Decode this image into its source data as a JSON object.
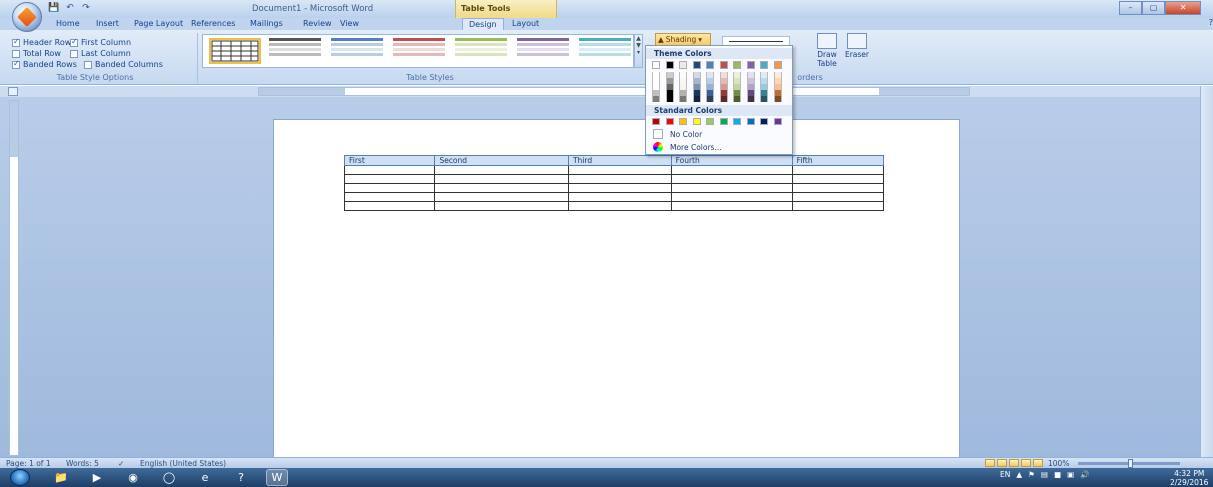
{
  "window": {
    "title": "Document1 - Microsoft Word",
    "context_tab": "Table Tools",
    "controls": [
      "–",
      "▢",
      "✕"
    ]
  },
  "tabs": [
    "Home",
    "Insert",
    "Page Layout",
    "References",
    "Mailings",
    "Review",
    "View",
    "Design",
    "Layout"
  ],
  "active_tab": "Design",
  "ribbon": {
    "table_style_options": {
      "label": "Table Style Options",
      "options": [
        {
          "label": "Header Row",
          "checked": true
        },
        {
          "label": "First Column",
          "checked": true
        },
        {
          "label": "Total Row",
          "checked": false
        },
        {
          "label": "Last Column",
          "checked": false
        },
        {
          "label": "Banded Rows",
          "checked": true
        },
        {
          "label": "Banded Columns",
          "checked": false
        }
      ]
    },
    "table_styles": {
      "label": "Table Styles"
    },
    "shading_button": "Shading",
    "borders_label": "orders",
    "draw_table": "Draw Table",
    "eraser": "Eraser"
  },
  "shading_menu": {
    "theme_colors_label": "Theme Colors",
    "standard_colors_label": "Standard Colors",
    "no_color": "No Color",
    "more_colors": "More Colors...",
    "theme_row": [
      "#ffffff",
      "#000000",
      "#eeece1",
      "#1f497d",
      "#4f81bd",
      "#c0504d",
      "#9bbb59",
      "#8064a2",
      "#4bacc6",
      "#f79646"
    ],
    "standard_row": [
      "#c00000",
      "#ff0000",
      "#ffc000",
      "#ffff00",
      "#92d050",
      "#00b050",
      "#00b0f0",
      "#0070c0",
      "#002060",
      "#7030a0"
    ]
  },
  "document_table": {
    "headers": [
      "First",
      "Second",
      "Third",
      "Fourth",
      "Fifth"
    ],
    "empty_rows": 5
  },
  "statusbar": {
    "page": "Page: 1 of 1",
    "words": "Words: 5",
    "language": "English (United States)",
    "zoom": "100%"
  },
  "taskbar": {
    "language": "EN",
    "time": "4:32 PM",
    "date": "2/29/2016"
  },
  "colors": {
    "accent": "#4f81bd",
    "ribbon": "#c6d9f1"
  }
}
